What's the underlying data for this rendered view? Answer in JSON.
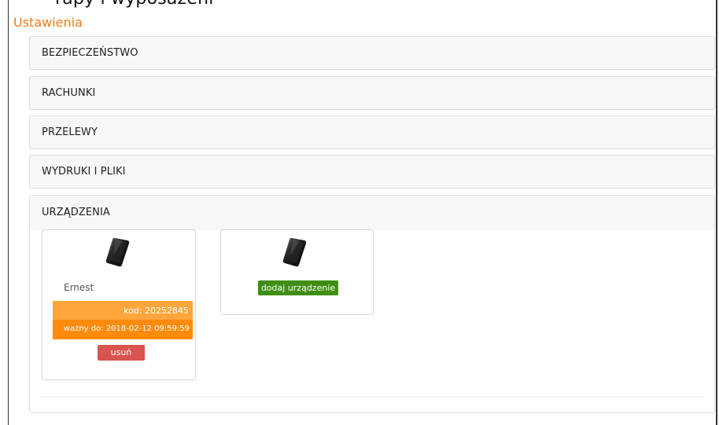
{
  "top_heading": "rapy i wyposażeni",
  "page_title": "Ustawienia",
  "panels": [
    {
      "label": "BEZPIECZEŃSTWO"
    },
    {
      "label": "RACHUNKI"
    },
    {
      "label": "PRZELEWY"
    },
    {
      "label": "WYDRUKI I PLIKI"
    },
    {
      "label": "URZĄDZENIA"
    }
  ],
  "devices": {
    "registered": {
      "name": "Ernest",
      "code": "kod: 20252845",
      "valid_until": "ważny do: 2018-02-12 09:59:59",
      "remove_label": "usuń"
    },
    "add_label": "dodaj urządzenie"
  },
  "colors": {
    "title_orange": "#f07c1a",
    "code_light": "#ffa53c",
    "code_dark": "#ff8a0c",
    "remove_red": "#d9534f",
    "add_green": "#3f8e12"
  }
}
